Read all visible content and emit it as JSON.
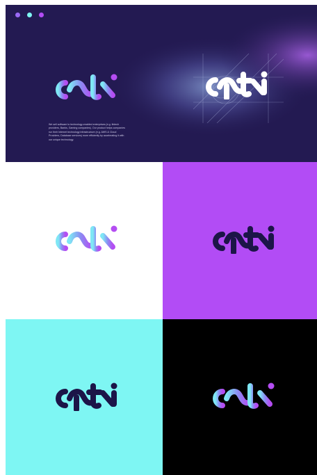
{
  "brand": {
    "name": "opti"
  },
  "colors": {
    "hero_bg": "#241a54",
    "purple": "#b24cf5",
    "cyan": "#7ef6f3",
    "navy": "#1c1548",
    "black": "#000000",
    "white": "#ffffff",
    "gradient_start": "#7fe7f5",
    "gradient_mid": "#8b8cf2",
    "gradient_end": "#b44df2"
  },
  "window_dots": [
    {
      "color": "#9a69f5"
    },
    {
      "color": "#7ef6f3"
    },
    {
      "color": "#b24cf5"
    }
  ],
  "hero": {
    "description": "We sell software to technology-enabled enterprises (e.g. fintech providers, Banks, Gaming companies). Our product helps companies run their internet technology infrastructure (e.g. AWS & Cloud Providers, Database services) more efficiently by accelerating it with our unique technology."
  },
  "tiles": [
    {
      "id": "white",
      "background": "#ffffff",
      "logo_style": "gradient"
    },
    {
      "id": "purple",
      "background": "#b24cf5",
      "logo_style": "navy"
    },
    {
      "id": "cyan",
      "background": "#7ef6f3",
      "logo_style": "navy"
    },
    {
      "id": "black",
      "background": "#000000",
      "logo_style": "gradient"
    }
  ]
}
